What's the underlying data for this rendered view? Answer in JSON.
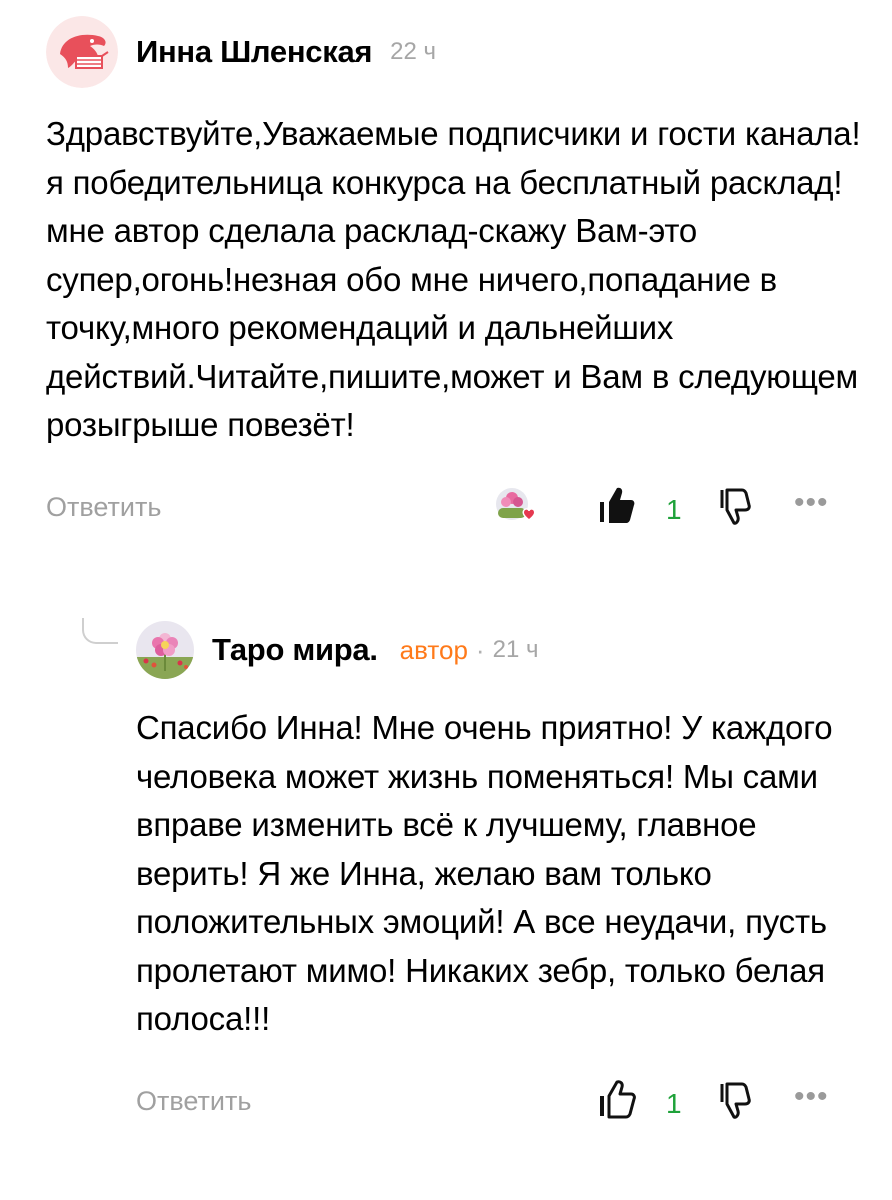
{
  "comments": [
    {
      "author": "Инна Шленская",
      "time": "22 ч",
      "text": "Здравствуйте,Уважаемые подписчики и гости канала!я победительница конкурса на бесплатный расклад!мне автор сделала расклад-скажу Вам-это супер,огонь!незная обо мне ничего,попадание в точку,много рекомендаций и дальнейших действий.Читайте,пишите,может и Вам в следующем розыгрыше повезёт!",
      "reply_label": "Ответить",
      "likes": "1",
      "more": "•••",
      "like_state": "filled",
      "colors": {
        "avatar": "#e8505b",
        "likes": "#1fa23a"
      }
    },
    {
      "author": "Таро мира.",
      "badge": "автор",
      "separator": "·",
      "time": "21 ч",
      "text": "Спасибо Инна! Мне очень приятно! У каждого человека может жизнь поменяться! Мы сами вправе изменить всё к лучшему, главное верить! Я же Инна, желаю вам только положительных эмоций! А все неудачи, пусть пролетают мимо! Никаких зебр, только белая полоса!!!",
      "reply_label": "Ответить",
      "likes": "1",
      "more": "•••",
      "like_state": "outline",
      "colors": {
        "badge": "#ff7a1a",
        "likes": "#1fa23a"
      }
    }
  ]
}
